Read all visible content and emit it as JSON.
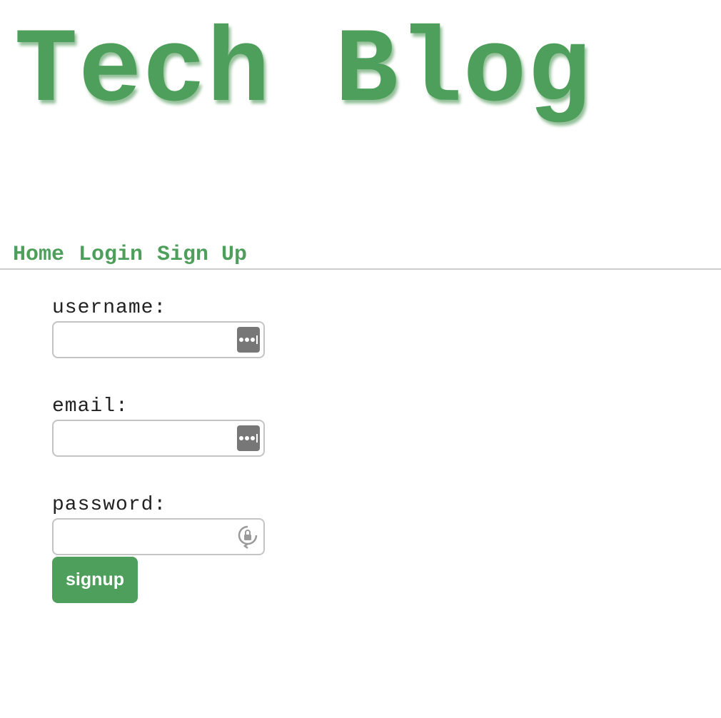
{
  "header": {
    "title": "Tech Blog"
  },
  "nav": {
    "items": [
      {
        "label": "Home"
      },
      {
        "label": "Login"
      },
      {
        "label": "Sign Up"
      }
    ]
  },
  "form": {
    "username": {
      "label": "username:",
      "value": "",
      "placeholder": ""
    },
    "email": {
      "label": "email:",
      "value": "",
      "placeholder": ""
    },
    "password": {
      "label": "password:",
      "value": "",
      "placeholder": ""
    },
    "submit_label": "signup"
  },
  "icons": {
    "username_autofill": "password-manager-icon",
    "email_autofill": "password-manager-icon",
    "password_generator": "password-generator-icon"
  },
  "colors": {
    "accent": "#4f9f5c",
    "text": "#222222",
    "divider": "#cccccc",
    "input_border": "#c4c4c4"
  }
}
